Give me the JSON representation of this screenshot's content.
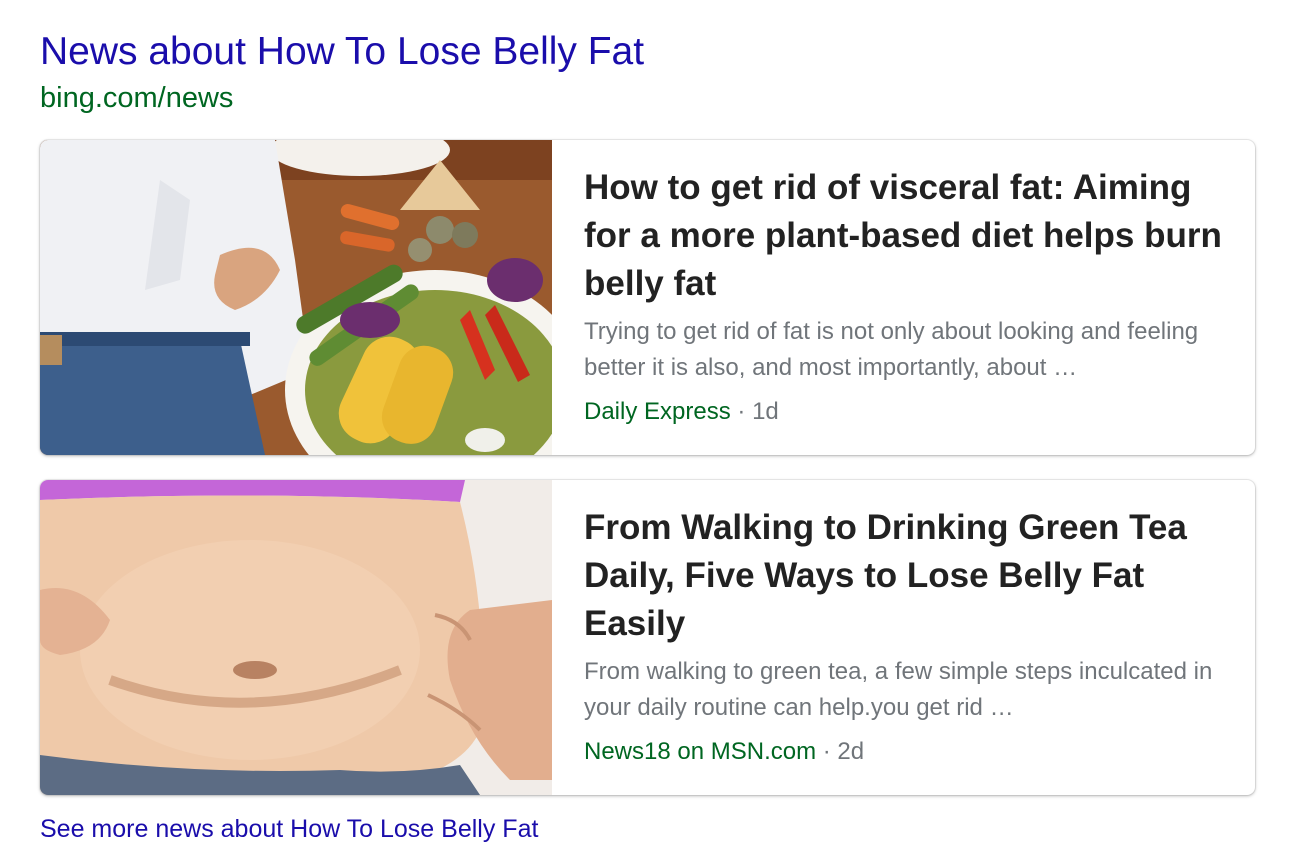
{
  "header": {
    "title": "News about How To Lose Belly Fat",
    "url": "bing.com/news"
  },
  "articles": [
    {
      "title": "How to get rid of visceral fat: Aiming for a more plant-based diet helps burn belly fat",
      "snippet": "Trying to get rid of fat is not only about looking and feeling better it is also, and most importantly, about …",
      "source": "Daily Express",
      "separator": "·",
      "age": "1d",
      "thumbnail_icon": "vegetable-platter-image"
    },
    {
      "title": "From Walking to Drinking Green Tea Daily, Five Ways to Lose Belly Fat Easily",
      "snippet": "From walking to green tea, a few simple steps inculcated in your daily routine can help.you get rid …",
      "source": "News18 on MSN.com",
      "separator": "·",
      "age": "2d",
      "thumbnail_icon": "belly-image"
    }
  ],
  "footer": {
    "see_more": "See more news about How To Lose Belly Fat"
  },
  "colors": {
    "link": "#1a0dab",
    "url_green": "#006621",
    "title_text": "#222222",
    "snippet_gray": "#70757a"
  }
}
